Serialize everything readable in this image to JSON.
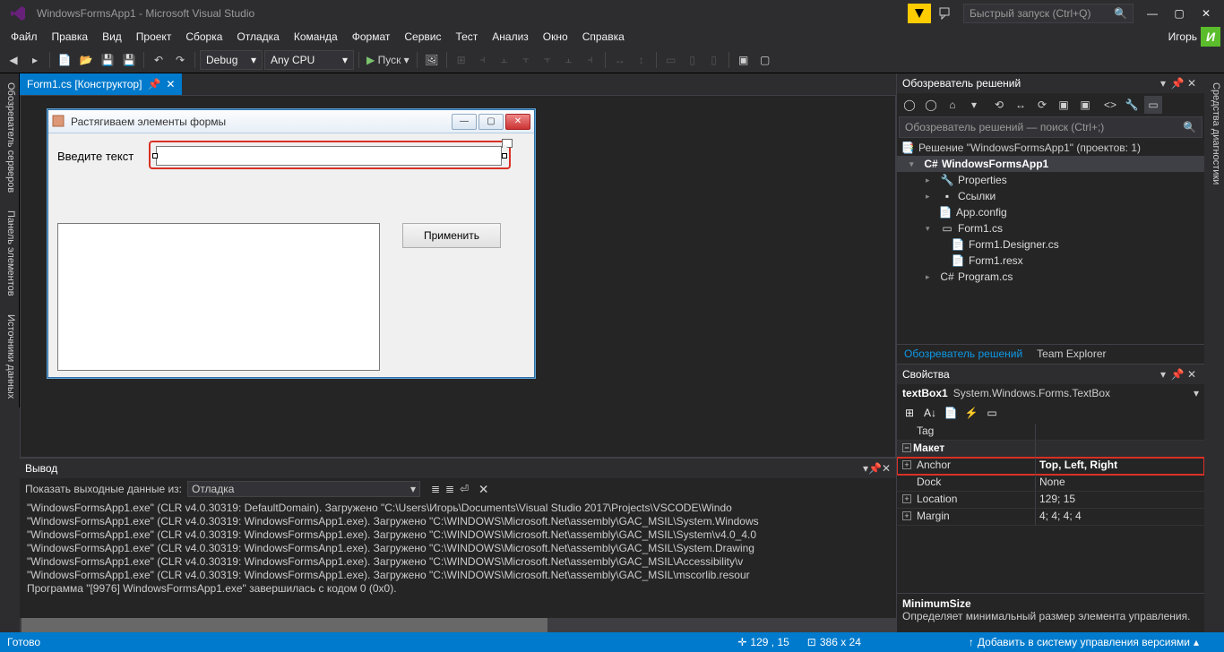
{
  "titlebar": {
    "title": "WindowsFormsApp1 - Microsoft Visual Studio",
    "quicklaunch_placeholder": "Быстрый запуск (Ctrl+Q)"
  },
  "menu": {
    "items": [
      "Файл",
      "Правка",
      "Вид",
      "Проект",
      "Сборка",
      "Отладка",
      "Команда",
      "Формат",
      "Сервис",
      "Тест",
      "Анализ",
      "Окно",
      "Справка"
    ],
    "user": "Игорь",
    "avatar": "И"
  },
  "toolbar": {
    "config": "Debug",
    "platform": "Any CPU",
    "run": "Пуск"
  },
  "doctab": {
    "label": "Form1.cs [Конструктор]"
  },
  "form": {
    "title": "Растягиваем элементы формы",
    "label": "Введите текст",
    "apply": "Применить"
  },
  "output": {
    "title": "Вывод",
    "show_from": "Показать выходные данные из:",
    "source": "Отладка",
    "lines": [
      "\"WindowsFormsApp1.exe\" (CLR v4.0.30319: DefaultDomain). Загружено \"C:\\Users\\Игорь\\Documents\\Visual Studio 2017\\Projects\\VSCODE\\Windo",
      "\"WindowsFormsApp1.exe\" (CLR v4.0.30319: WindowsFormsApp1.exe). Загружено \"C:\\WINDOWS\\Microsoft.Net\\assembly\\GAC_MSIL\\System.Windows",
      "\"WindowsFormsApp1.exe\" (CLR v4.0.30319: WindowsFormsApp1.exe). Загружено \"C:\\WINDOWS\\Microsoft.Net\\assembly\\GAC_MSIL\\System\\v4.0_4.0",
      "\"WindowsFormsApp1.exe\" (CLR v4.0.30319: WindowsFormsAnp1.exe). Загружено \"C:\\WINDOWS\\Microsoft.Net\\assembly\\GAC_MSIL\\System.Drawing",
      "\"WindowsFormsApp1.exe\" (CLR v4.0.30319: WindowsFormsApp1.exe). Загружено \"C:\\WINDOWS\\Microsoft.Net\\assembly\\GAC_MSIL\\Accessibility\\v",
      "\"WindowsFormsApp1.exe\" (CLR v4.0.30319: WindowsFormsApp1.exe). Загружено \"C:\\WINDOWS\\Microsoft.Net\\assembly\\GAC_MSIL\\mscorlib.resour",
      "Программа \"[9976] WindowsFormsApp1.exe\" завершилась с кодом 0 (0x0)."
    ]
  },
  "solutionexp": {
    "title": "Обозреватель решений",
    "search_placeholder": "Обозреватель решений — поиск (Ctrl+;)",
    "solution": "Решение \"WindowsFormsApp1\"  (проектов: 1)",
    "project": "WindowsFormsApp1",
    "nodes": {
      "properties": "Properties",
      "refs": "Ссылки",
      "appconfig": "App.config",
      "form1": "Form1.cs",
      "form1d": "Form1.Designer.cs",
      "form1r": "Form1.resx",
      "program": "Program.cs"
    },
    "tabs": {
      "sol": "Обозреватель решений",
      "team": "Team Explorer"
    }
  },
  "props": {
    "title": "Свойства",
    "object_name": "textBox1",
    "object_type": "System.Windows.Forms.TextBox",
    "rows": {
      "tag": {
        "n": "Tag",
        "v": ""
      },
      "layout_cat": "Макет",
      "anchor": {
        "n": "Anchor",
        "v": "Top, Left, Right"
      },
      "dock": {
        "n": "Dock",
        "v": "None"
      },
      "location": {
        "n": "Location",
        "v": "129; 15"
      },
      "margin": {
        "n": "Margin",
        "v": "4; 4; 4; 4"
      }
    },
    "desc_title": "MinimumSize",
    "desc_text": "Определяет минимальный размер элемента управления."
  },
  "left_tabs": [
    "Обозреватель серверов",
    "Панель элементов",
    "Источники данных"
  ],
  "right_tabs": [
    "Средства диагностики"
  ],
  "status": {
    "ready": "Готово",
    "pos": "129 , 15",
    "size": "386 x 24",
    "vcs": "Добавить в систему управления версиями"
  }
}
